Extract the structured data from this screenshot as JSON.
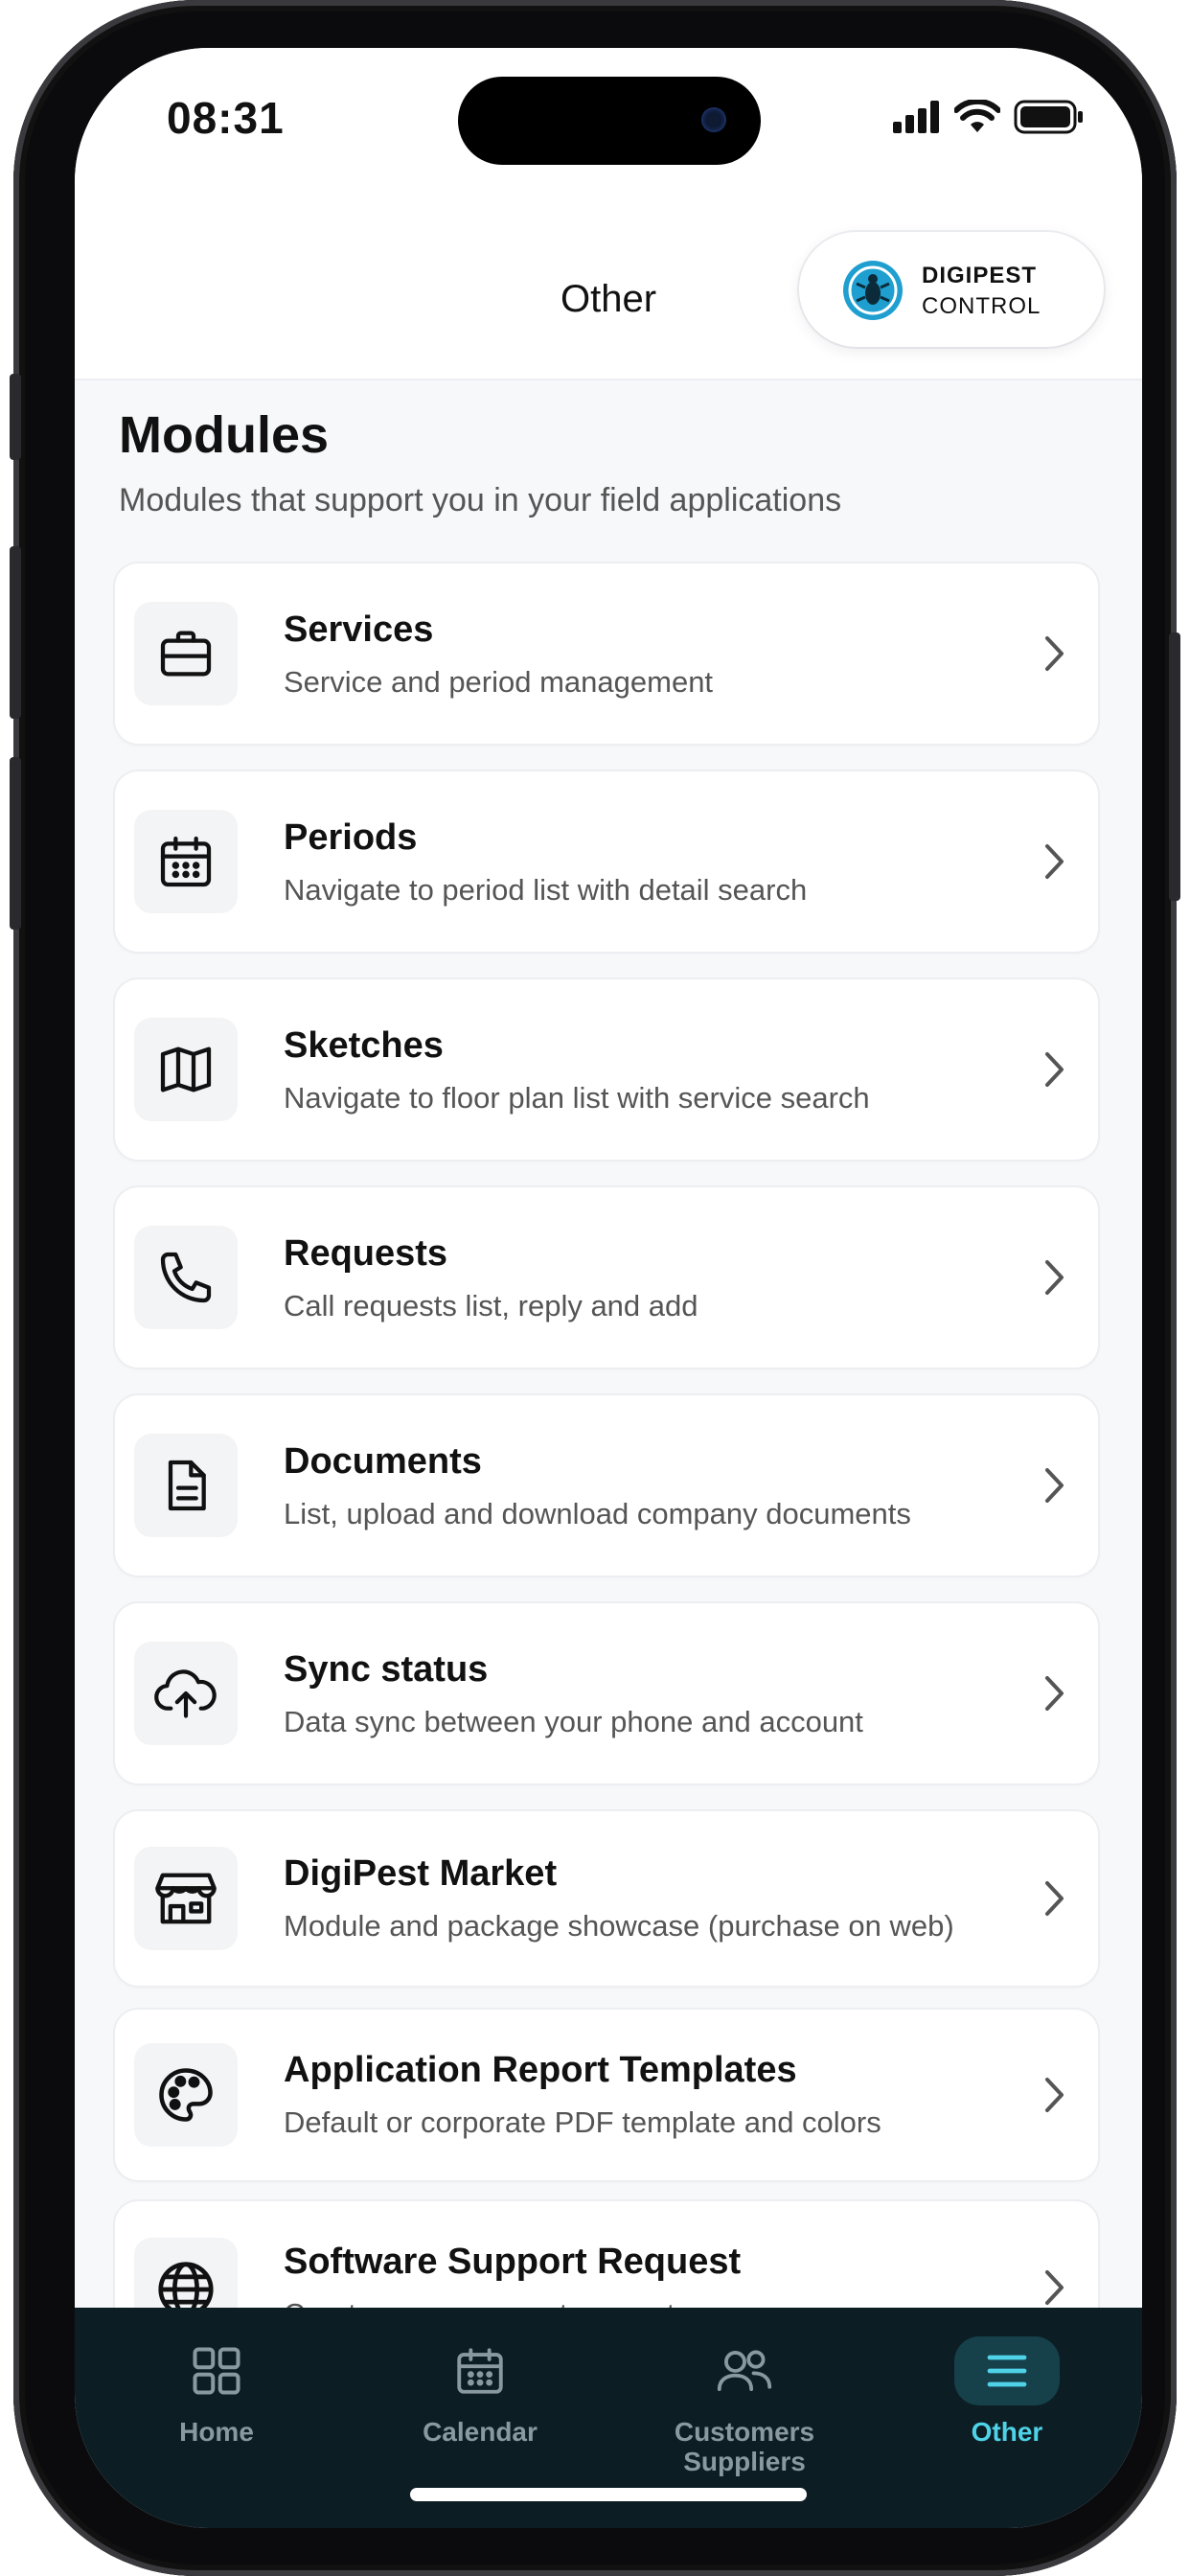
{
  "status": {
    "time": "08:31"
  },
  "header": {
    "title": "Other",
    "logo_line1": "DIGIPEST",
    "logo_line2": "CONTROL"
  },
  "modules": {
    "title": "Modules",
    "subtitle": "Modules that support you in your field applications",
    "items": [
      {
        "title": "Services",
        "desc": "Service and period management",
        "icon": "briefcase-icon"
      },
      {
        "title": "Periods",
        "desc": "Navigate to period list with detail search",
        "icon": "calendar-grid-icon"
      },
      {
        "title": "Sketches",
        "desc": "Navigate to floor plan list with service search",
        "icon": "map-icon"
      },
      {
        "title": "Requests",
        "desc": "Call requests list, reply and add",
        "icon": "phone-icon"
      },
      {
        "title": "Documents",
        "desc": "List, upload and download company documents",
        "icon": "document-icon"
      },
      {
        "title": "Sync status",
        "desc": "Data sync between your phone and account",
        "icon": "cloud-upload-icon"
      },
      {
        "title": "DigiPest Market",
        "desc": "Module and package showcase (purchase on web)",
        "icon": "store-icon"
      },
      {
        "title": "Application Report Templates",
        "desc": "Default or corporate PDF template and colors",
        "icon": "palette-icon"
      },
      {
        "title": "Software Support Request",
        "desc": "Create a new support request",
        "icon": "globe-icon"
      }
    ]
  },
  "tabbar": {
    "home": "Home",
    "calendar": "Calendar",
    "customers_1": "Customers",
    "customers_2": "Suppliers",
    "other": "Other"
  },
  "colors": {
    "accent": "#4fd2e8",
    "tabbar_bg": "#0c1e24",
    "logo_blue": "#1f9fd0"
  }
}
